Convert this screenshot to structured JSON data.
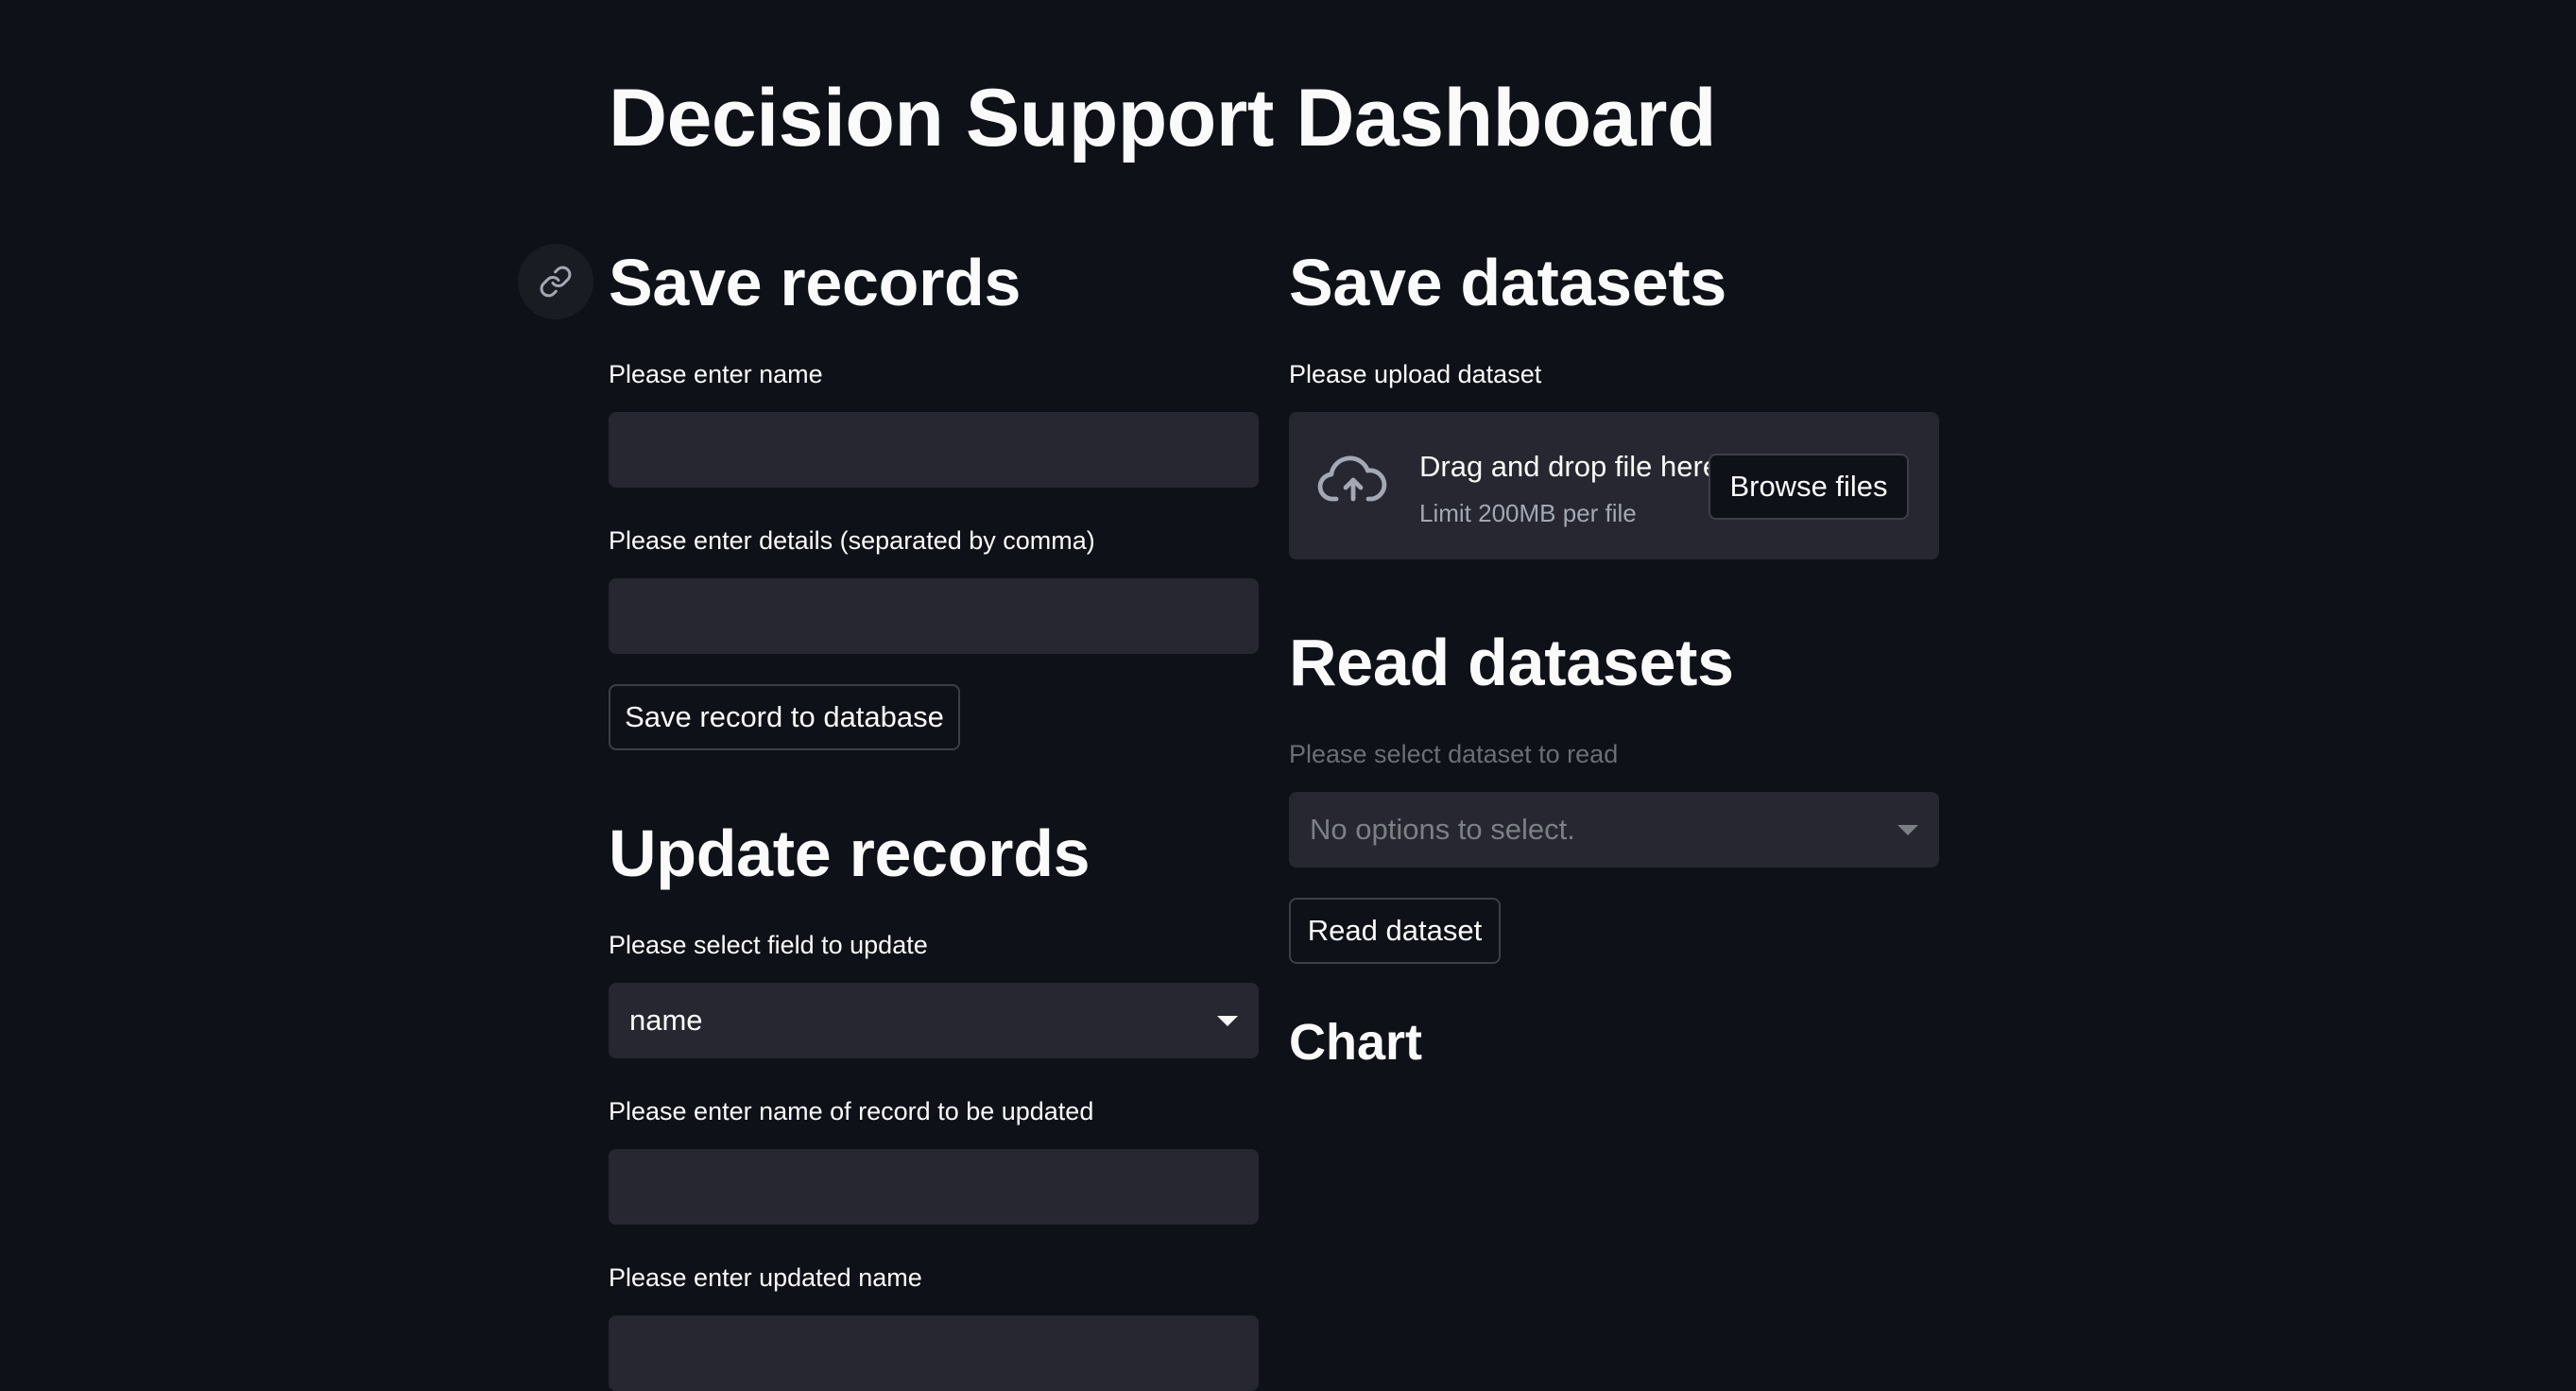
{
  "page": {
    "title": "Decision Support Dashboard"
  },
  "save_records": {
    "heading": "Save records",
    "name_label": "Please enter name",
    "name_value": "",
    "details_label": "Please enter details (separated by comma)",
    "details_value": "",
    "save_button": "Save record to database"
  },
  "update_records": {
    "heading": "Update records",
    "field_label": "Please select field to update",
    "field_selected": "name",
    "record_name_label": "Please enter name of record to be updated",
    "record_name_value": "",
    "updated_name_label": "Please enter updated name",
    "updated_name_value": ""
  },
  "save_datasets": {
    "heading": "Save datasets",
    "upload_label": "Please upload dataset",
    "drop_text": "Drag and drop file here",
    "limit_text": "Limit 200MB per file",
    "browse_button": "Browse files"
  },
  "read_datasets": {
    "heading": "Read datasets",
    "select_label": "Please select dataset to read",
    "select_value": "No options to select.",
    "read_button": "Read dataset"
  },
  "chart": {
    "heading": "Chart"
  },
  "icons": {
    "anchor": "link-icon",
    "upload": "cloud-upload-icon",
    "dropdown": "chevron-down-icon"
  },
  "colors": {
    "background": "#0e1117",
    "input_background": "#262730",
    "text": "#fafafa",
    "muted_text": "#a3a8b4"
  }
}
